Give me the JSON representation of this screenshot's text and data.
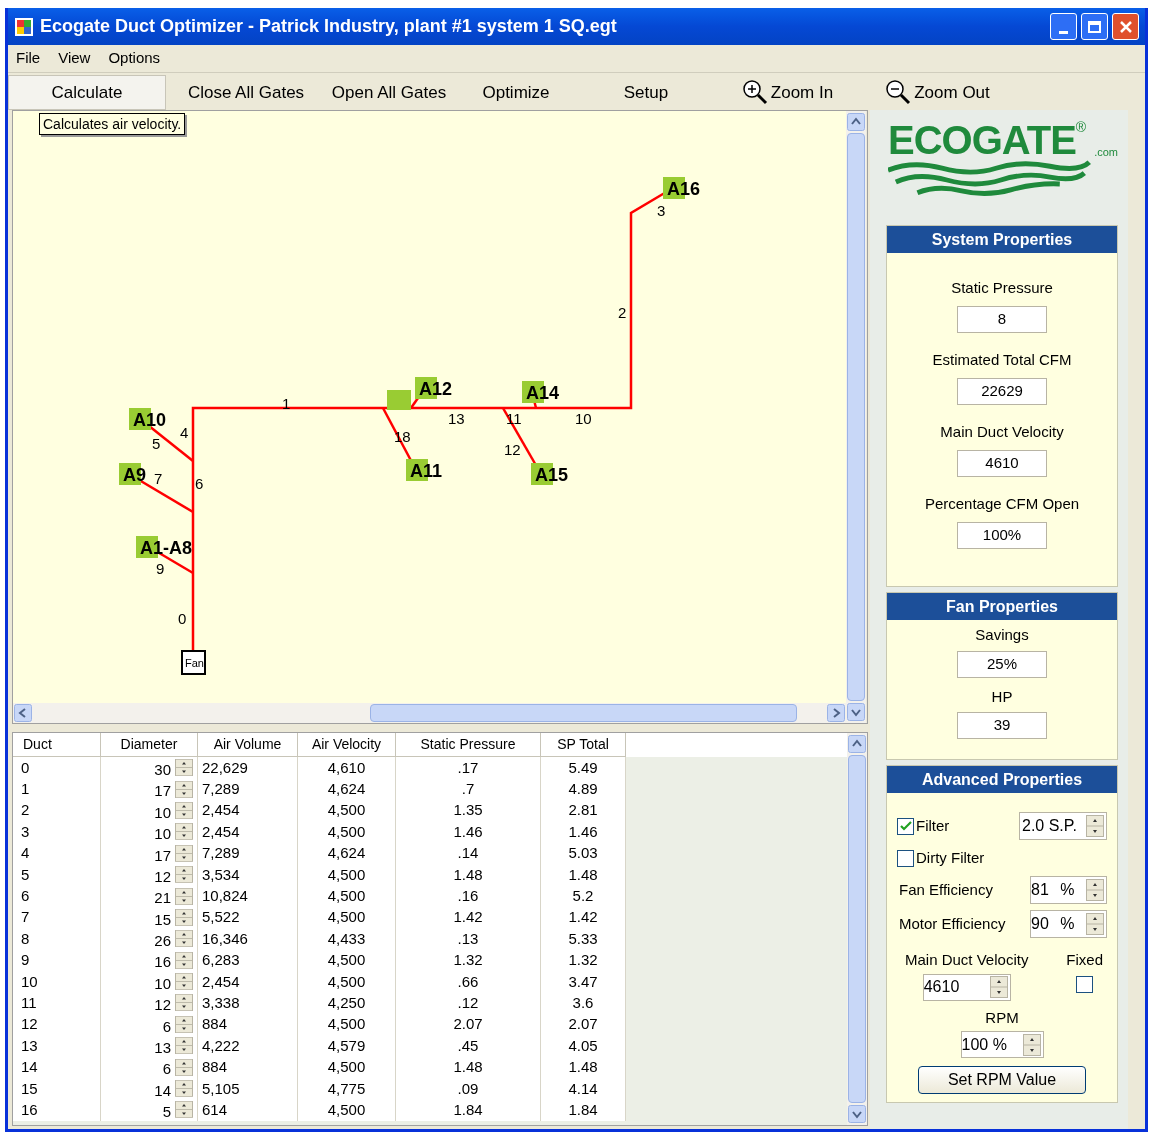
{
  "window": {
    "title": "Ecogate Duct Optimizer - Patrick Industry, plant #1 system 1 SQ.egt"
  },
  "menu": [
    "File",
    "View",
    "Options"
  ],
  "toolbar": [
    {
      "label": "Calculate",
      "kind": "button",
      "selected": true
    },
    {
      "label": "Close All Gates",
      "kind": "button",
      "selected": false
    },
    {
      "label": "Open All Gates",
      "kind": "button",
      "selected": false
    },
    {
      "label": "Optimize",
      "kind": "button",
      "selected": false
    },
    {
      "label": "Setup",
      "kind": "button",
      "selected": false
    },
    {
      "label": "Zoom In",
      "kind": "zoom-in",
      "selected": false
    },
    {
      "label": "Zoom Out",
      "kind": "zoom-out",
      "selected": false
    }
  ],
  "diagram": {
    "tooltip": "Calculates air velocity.",
    "fan": "Fan",
    "gates": [
      "A16",
      "A10",
      "A9",
      "A1-A8",
      "A12",
      "A14",
      "A11",
      "A15"
    ],
    "duct_labels": [
      "3",
      "2",
      "1",
      "13",
      "11",
      "10",
      "5",
      "4",
      "18",
      "12",
      "7",
      "6",
      "9",
      "0"
    ]
  },
  "table": {
    "columns": [
      "Duct",
      "Diameter",
      "Air Volume",
      "Air Velocity",
      "Static Pressure",
      "SP Total"
    ],
    "rows": [
      [
        "0",
        "30",
        "22,629",
        "4,610",
        ".17",
        "5.49"
      ],
      [
        "1",
        "17",
        "7,289",
        "4,624",
        ".7",
        "4.89"
      ],
      [
        "2",
        "10",
        "2,454",
        "4,500",
        "1.35",
        "2.81"
      ],
      [
        "3",
        "10",
        "2,454",
        "4,500",
        "1.46",
        "1.46"
      ],
      [
        "4",
        "17",
        "7,289",
        "4,624",
        ".14",
        "5.03"
      ],
      [
        "5",
        "12",
        "3,534",
        "4,500",
        "1.48",
        "1.48"
      ],
      [
        "6",
        "21",
        "10,824",
        "4,500",
        ".16",
        "5.2"
      ],
      [
        "7",
        "15",
        "5,522",
        "4,500",
        "1.42",
        "1.42"
      ],
      [
        "8",
        "26",
        "16,346",
        "4,433",
        ".13",
        "5.33"
      ],
      [
        "9",
        "16",
        "6,283",
        "4,500",
        "1.32",
        "1.32"
      ],
      [
        "10",
        "10",
        "2,454",
        "4,500",
        ".66",
        "3.47"
      ],
      [
        "11",
        "12",
        "3,338",
        "4,250",
        ".12",
        "3.6"
      ],
      [
        "12",
        "6",
        "884",
        "4,500",
        "2.07",
        "2.07"
      ],
      [
        "13",
        "13",
        "4,222",
        "4,579",
        ".45",
        "4.05"
      ],
      [
        "14",
        "6",
        "884",
        "4,500",
        "1.48",
        "1.48"
      ],
      [
        "15",
        "14",
        "5,105",
        "4,775",
        ".09",
        "4.14"
      ],
      [
        "16",
        "5",
        "614",
        "4,500",
        "1.84",
        "1.84"
      ]
    ]
  },
  "logo": {
    "name": "ECOGATE",
    "mark": "®",
    "suffix": ".com"
  },
  "system_properties": {
    "title": "System Properties",
    "fields": [
      {
        "label": "Static Pressure",
        "value": "8"
      },
      {
        "label": "Estimated Total CFM",
        "value": "22629"
      },
      {
        "label": "Main Duct Velocity",
        "value": "4610"
      },
      {
        "label": "Percentage CFM Open",
        "value": "100%"
      }
    ]
  },
  "fan_properties": {
    "title": "Fan Properties",
    "fields": [
      {
        "label": "Savings",
        "value": "25%"
      },
      {
        "label": "HP",
        "value": "39"
      }
    ]
  },
  "advanced_properties": {
    "title": "Advanced Properties",
    "filter": {
      "label": "Filter",
      "checked": true,
      "value": "2.0 S.P."
    },
    "dirty_filter": {
      "label": "Dirty Filter",
      "checked": false
    },
    "efficiencies": [
      {
        "label": "Fan Efficiency",
        "value": "81",
        "unit": "%"
      },
      {
        "label": "Motor Efficiency",
        "value": "90",
        "unit": "%"
      }
    ],
    "main_duct_velocity": {
      "label": "Main Duct Velocity",
      "value": "4610"
    },
    "fixed": {
      "label": "Fixed",
      "checked": false
    },
    "rpm": {
      "label": "RPM",
      "value": "100 %"
    },
    "button": "Set RPM Value"
  }
}
